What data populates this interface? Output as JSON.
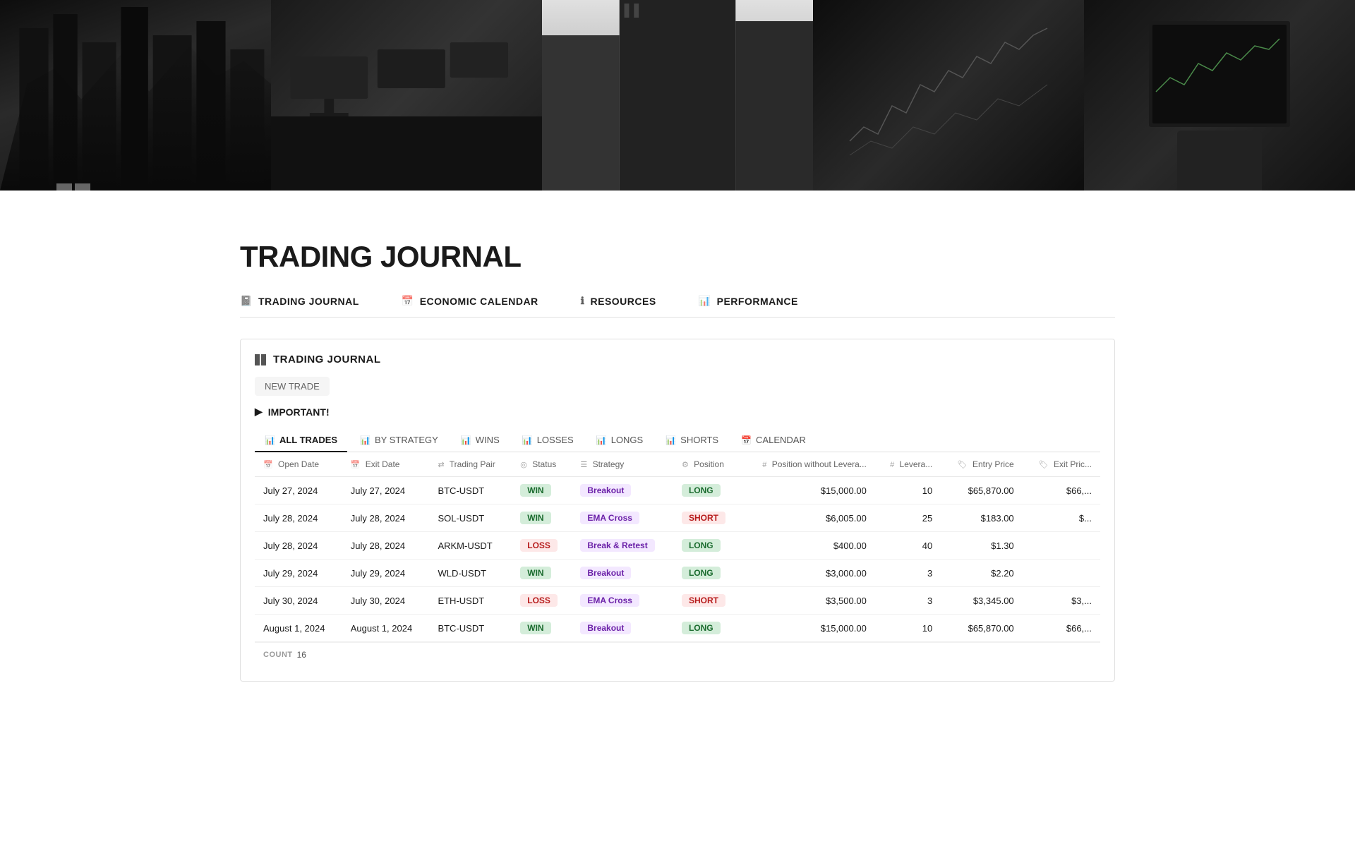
{
  "hero": {
    "panels": [
      "buildings-dark",
      "trading-monitors",
      "building-perspective",
      "stock-chart",
      "phone-trading"
    ]
  },
  "page": {
    "title": "TRADING JOURNAL"
  },
  "nav": {
    "items": [
      {
        "id": "trading-journal",
        "icon": "📓",
        "label": "TRADING JOURNAL"
      },
      {
        "id": "economic-calendar",
        "icon": "📅",
        "label": "ECONOMIC CALENDAR"
      },
      {
        "id": "resources",
        "icon": "ℹ",
        "label": "RESOURCES"
      },
      {
        "id": "performance",
        "icon": "📊",
        "label": "PERFORMANCE"
      }
    ]
  },
  "journal": {
    "title": "TRADING JOURNAL",
    "new_trade_label": "NEW TRADE",
    "important_label": "IMPORTANT!",
    "tabs": [
      {
        "id": "all-trades",
        "icon": "📊",
        "label": "ALL TRADES",
        "active": true
      },
      {
        "id": "by-strategy",
        "icon": "📊",
        "label": "BY STRATEGY",
        "active": false
      },
      {
        "id": "wins",
        "icon": "📊",
        "label": "WINS",
        "active": false
      },
      {
        "id": "losses",
        "icon": "📊",
        "label": "LOSSES",
        "active": false
      },
      {
        "id": "longs",
        "icon": "📊",
        "label": "LONGS",
        "active": false
      },
      {
        "id": "shorts",
        "icon": "📊",
        "label": "SHORTS",
        "active": false
      },
      {
        "id": "calendar",
        "icon": "📅",
        "label": "CALENDAR",
        "active": false
      }
    ],
    "columns": [
      {
        "id": "open-date",
        "icon": "📅",
        "label": "Open Date"
      },
      {
        "id": "exit-date",
        "icon": "📅",
        "label": "Exit Date"
      },
      {
        "id": "trading-pair",
        "icon": "⇄",
        "label": "Trading Pair"
      },
      {
        "id": "status",
        "icon": "◎",
        "label": "Status"
      },
      {
        "id": "strategy",
        "icon": "☰",
        "label": "Strategy"
      },
      {
        "id": "position",
        "icon": "⚙",
        "label": "Position"
      },
      {
        "id": "position-wo-leverage",
        "icon": "#",
        "label": "Position without Levera..."
      },
      {
        "id": "leverage",
        "icon": "#",
        "label": "Levera..."
      },
      {
        "id": "entry-price",
        "icon": "🏷",
        "label": "Entry Price"
      },
      {
        "id": "exit-price",
        "icon": "🏷",
        "label": "Exit Pric..."
      }
    ],
    "rows": [
      {
        "open_date": "July 27, 2024",
        "exit_date": "July 27, 2024",
        "trading_pair": "BTC-USDT",
        "status": "WIN",
        "strategy": "Breakout",
        "position": "LONG",
        "position_wo_leverage": "$15,000.00",
        "leverage": "10",
        "entry_price": "$65,870.00",
        "exit_price": "$66,..."
      },
      {
        "open_date": "July 28, 2024",
        "exit_date": "July 28, 2024",
        "trading_pair": "SOL-USDT",
        "status": "WIN",
        "strategy": "EMA Cross",
        "position": "SHORT",
        "position_wo_leverage": "$6,005.00",
        "leverage": "25",
        "entry_price": "$183.00",
        "exit_price": "$..."
      },
      {
        "open_date": "July 28, 2024",
        "exit_date": "July 28, 2024",
        "trading_pair": "ARKM-USDT",
        "status": "LOSS",
        "strategy": "Break & Retest",
        "position": "LONG",
        "position_wo_leverage": "$400.00",
        "leverage": "40",
        "entry_price": "$1.30",
        "exit_price": ""
      },
      {
        "open_date": "July 29, 2024",
        "exit_date": "July 29, 2024",
        "trading_pair": "WLD-USDT",
        "status": "WIN",
        "strategy": "Breakout",
        "position": "LONG",
        "position_wo_leverage": "$3,000.00",
        "leverage": "3",
        "entry_price": "$2.20",
        "exit_price": ""
      },
      {
        "open_date": "July 30, 2024",
        "exit_date": "July 30, 2024",
        "trading_pair": "ETH-USDT",
        "status": "LOSS",
        "strategy": "EMA Cross",
        "position": "SHORT",
        "position_wo_leverage": "$3,500.00",
        "leverage": "3",
        "entry_price": "$3,345.00",
        "exit_price": "$3,..."
      },
      {
        "open_date": "August 1, 2024",
        "exit_date": "August 1, 2024",
        "trading_pair": "BTC-USDT",
        "status": "WIN",
        "strategy": "Breakout",
        "position": "LONG",
        "position_wo_leverage": "$15,000.00",
        "leverage": "10",
        "entry_price": "$65,870.00",
        "exit_price": "$66,..."
      }
    ],
    "footer": {
      "count_label": "COUNT",
      "count_value": "16"
    }
  }
}
